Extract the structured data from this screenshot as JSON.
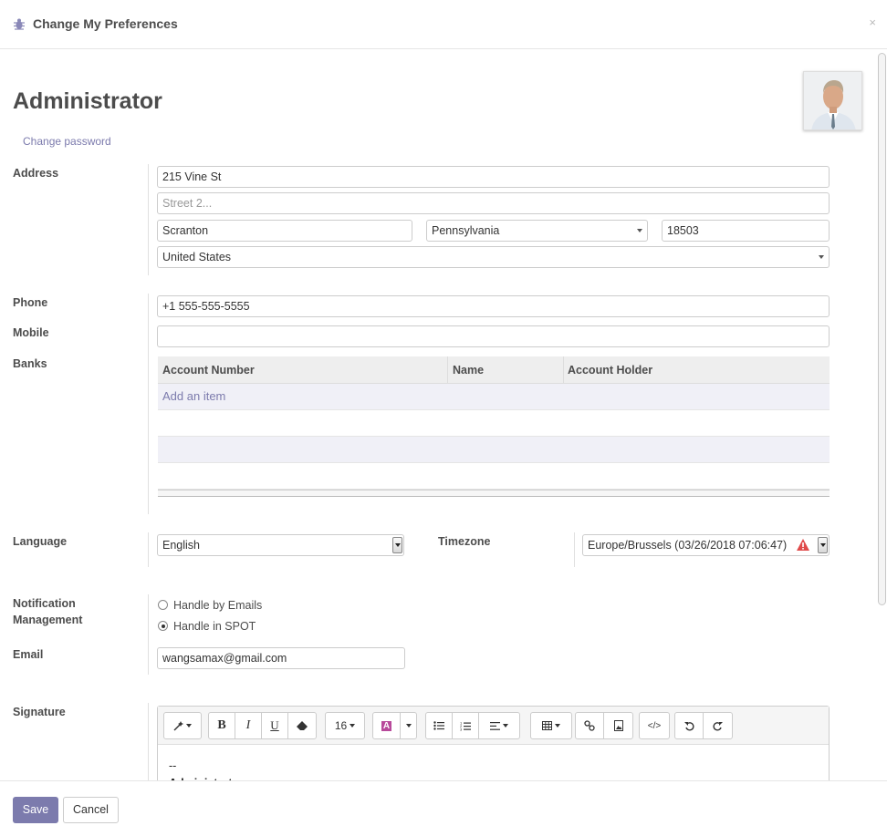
{
  "dialog": {
    "title": "Change My Preferences",
    "close_label": "×"
  },
  "user": {
    "name": "Administrator",
    "change_password": "Change password"
  },
  "labels": {
    "address": "Address",
    "phone": "Phone",
    "mobile": "Mobile",
    "banks": "Banks",
    "language": "Language",
    "timezone": "Timezone",
    "notification_line1": "Notification",
    "notification_line2": "Management",
    "email": "Email",
    "signature": "Signature"
  },
  "address": {
    "street": "215 Vine St",
    "street2_placeholder": "Street 2...",
    "city": "Scranton",
    "state": "Pennsylvania",
    "zip": "18503",
    "country": "United States"
  },
  "phone": "+1 555-555-5555",
  "mobile": "",
  "banks": {
    "columns": [
      "Account Number",
      "Name",
      "Account Holder"
    ],
    "add_item": "Add an item"
  },
  "language": "English",
  "timezone": "Europe/Brussels (03/26/2018 07:06:47)",
  "notification": {
    "options": [
      "Handle by Emails",
      "Handle in SPOT"
    ],
    "selected": "Handle in SPOT"
  },
  "email": "wangsamax@gmail.com",
  "signature": {
    "font_size": "16",
    "line1": "--",
    "line2": "Administrator"
  },
  "footer": {
    "save": "Save",
    "cancel": "Cancel"
  },
  "colors": {
    "primary": "#7c7bad",
    "warning": "#e04a4a"
  }
}
